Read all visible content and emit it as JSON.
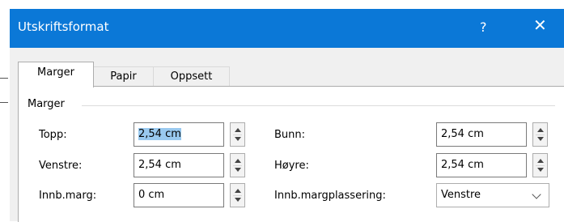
{
  "window": {
    "title": "Utskriftsformat",
    "help": "?",
    "close": "✕"
  },
  "tabs": [
    {
      "label": "Marger",
      "active": true
    },
    {
      "label": "Papir",
      "active": false
    },
    {
      "label": "Oppsett",
      "active": false
    }
  ],
  "section": {
    "title": "Marger"
  },
  "fields": {
    "top": {
      "label": "Topp:",
      "value": "2,54 cm"
    },
    "left": {
      "label": "Venstre:",
      "value": "2,54 cm"
    },
    "gutter": {
      "label": "Innb.marg:",
      "value": "0 cm"
    },
    "bottom": {
      "label": "Bunn:",
      "value": "2,54 cm"
    },
    "right": {
      "label": "Høyre:",
      "value": "2,54 cm"
    },
    "gutter_position": {
      "label": "Innb.margplassering:",
      "value": "Venstre"
    }
  },
  "colors": {
    "titlebar": "#0B78D7",
    "selection": "#99C9EF",
    "dialog_bg": "#F0F0F0"
  },
  "icons": {
    "close": "close-icon",
    "help": "help-icon",
    "spin": "spin-button-icon",
    "dropdown": "chevron-down-icon"
  }
}
